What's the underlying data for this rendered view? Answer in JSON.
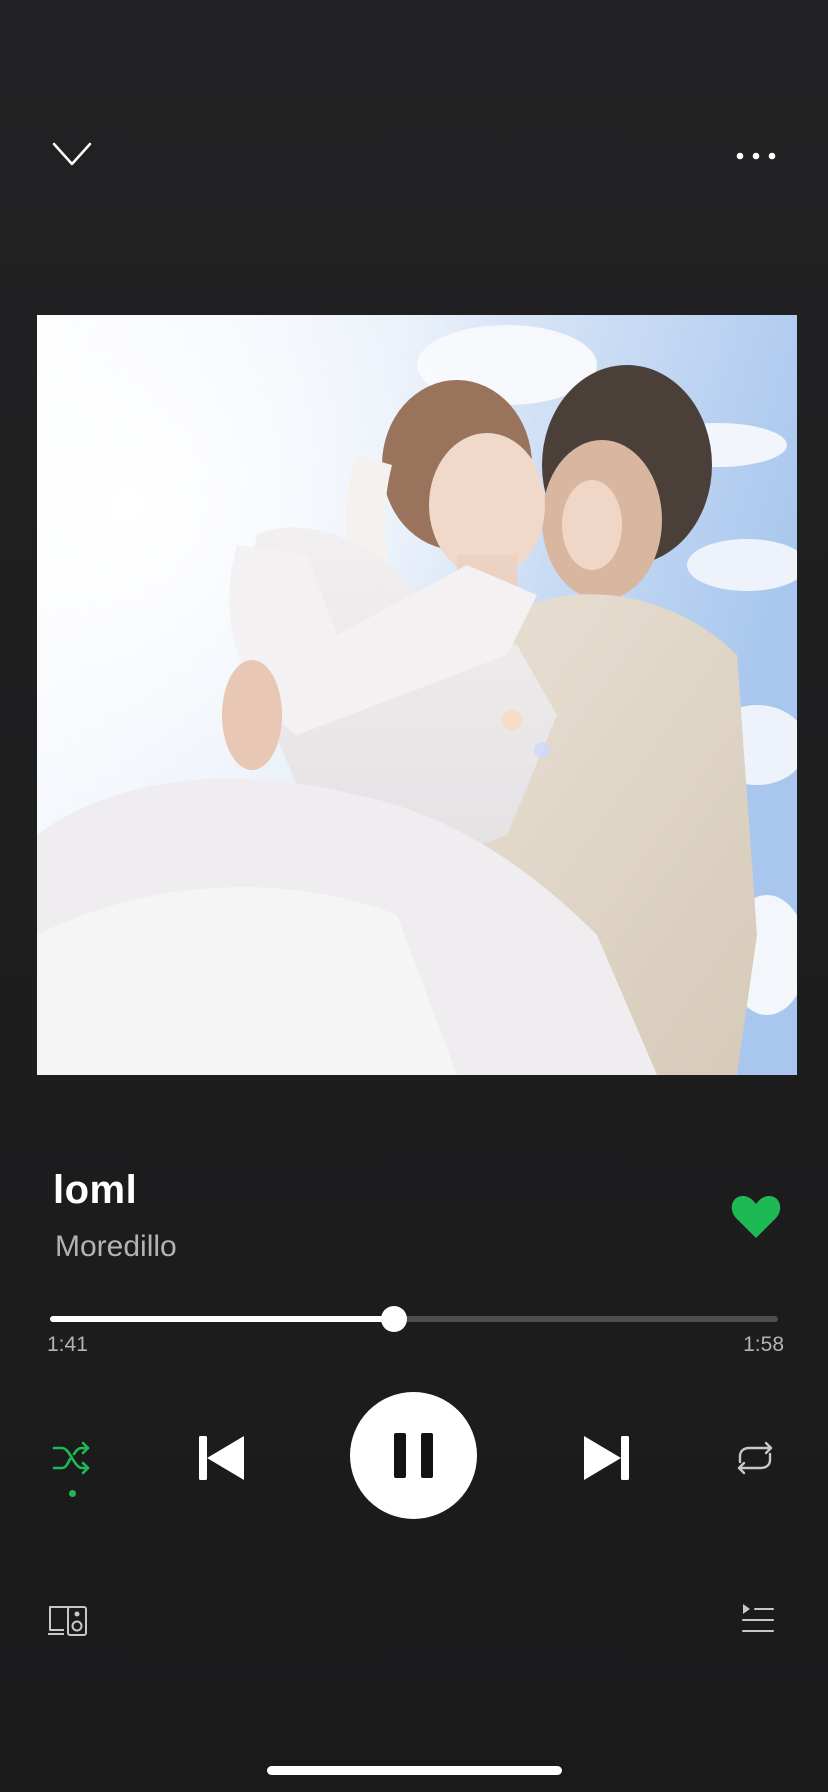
{
  "header": {
    "collapse_icon": "chevron-down-icon",
    "more_icon": "more-horizontal-icon"
  },
  "album_art": {
    "icon": "album-art-image"
  },
  "track": {
    "title": "loml",
    "artist": "Moredillo",
    "liked": true
  },
  "progress": {
    "elapsed": "1:41",
    "total": "1:58",
    "fraction": 0.473
  },
  "controls": {
    "shuffle_icon": "shuffle-icon",
    "shuffle_active": true,
    "previous_icon": "skip-previous-icon",
    "play_state_icon": "pause-icon",
    "next_icon": "skip-next-icon",
    "repeat_icon": "repeat-icon"
  },
  "footer": {
    "devices_icon": "connect-devices-icon",
    "queue_icon": "queue-icon"
  },
  "colors": {
    "accent": "#1db954",
    "background": "#1e1e1f",
    "text_primary": "#ffffff",
    "text_secondary": "#b3b3b3",
    "track_bg": "#4d4d4f"
  }
}
